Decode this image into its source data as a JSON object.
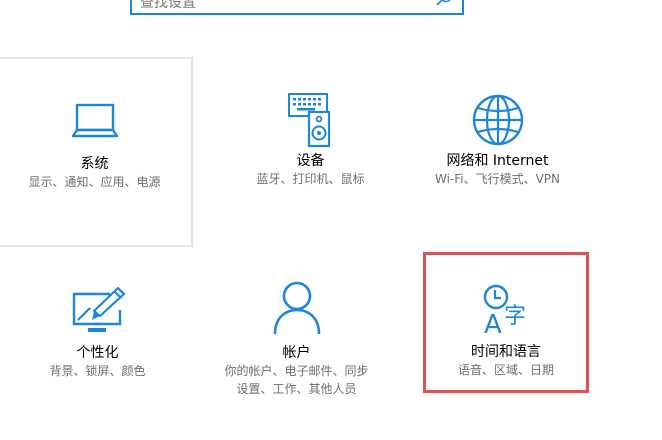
{
  "search": {
    "placeholder": "查找设置"
  },
  "tiles": [
    {
      "title": "系统",
      "desc": "显示、通知、应用、电源",
      "icon": "laptop-icon"
    },
    {
      "title": "设备",
      "desc": "蓝牙、打印机、鼠标",
      "icon": "devices-icon"
    },
    {
      "title": "网络和 Internet",
      "desc": "Wi-Fi、飞行模式、VPN",
      "icon": "globe-icon"
    },
    {
      "title": "个性化",
      "desc": "背景、锁屏、颜色",
      "icon": "personalization-icon"
    },
    {
      "title": "帐户",
      "desc_line1": "你的帐户、电子邮件、同步",
      "desc_line2": "设置、工作、其他人员",
      "icon": "person-icon"
    },
    {
      "title": "时间和语言",
      "desc": "语音、区域、日期",
      "icon": "time-language-icon"
    }
  ],
  "colors": {
    "accent": "#1e86d6",
    "highlight_border": "#e05252",
    "tile_border": "#e6e6e6",
    "desc_text": "#6e6e6e"
  }
}
